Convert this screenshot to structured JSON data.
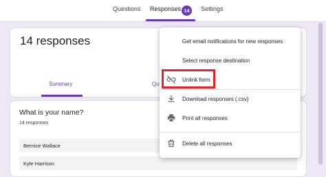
{
  "tabs": {
    "questions": "Questions",
    "responses": "Responses",
    "responses_count": "14",
    "settings": "Settings"
  },
  "summary_card": {
    "title": "14 responses",
    "subtab_summary": "Summary",
    "subtab_question_partial": "Qu"
  },
  "question_card": {
    "title": "What is your name?",
    "count": "14 responses",
    "answers": [
      "Bernice Wallace",
      "Kyle Harrison"
    ]
  },
  "menu": {
    "items": [
      {
        "label": "Get email notifications for new responses",
        "icon": "none"
      },
      {
        "label": "Select response destination",
        "icon": "none"
      },
      {
        "label": "Unlink form",
        "icon": "link-off-icon"
      },
      {
        "label": "Download responses (.csv)",
        "icon": "download-icon"
      },
      {
        "label": "Print all responses",
        "icon": "printer-icon"
      },
      {
        "label": "Delete all responses",
        "icon": "trash-icon"
      }
    ]
  },
  "colors": {
    "accent": "#673ab7",
    "background": "#ede7f6",
    "highlight": "#e8202a"
  }
}
